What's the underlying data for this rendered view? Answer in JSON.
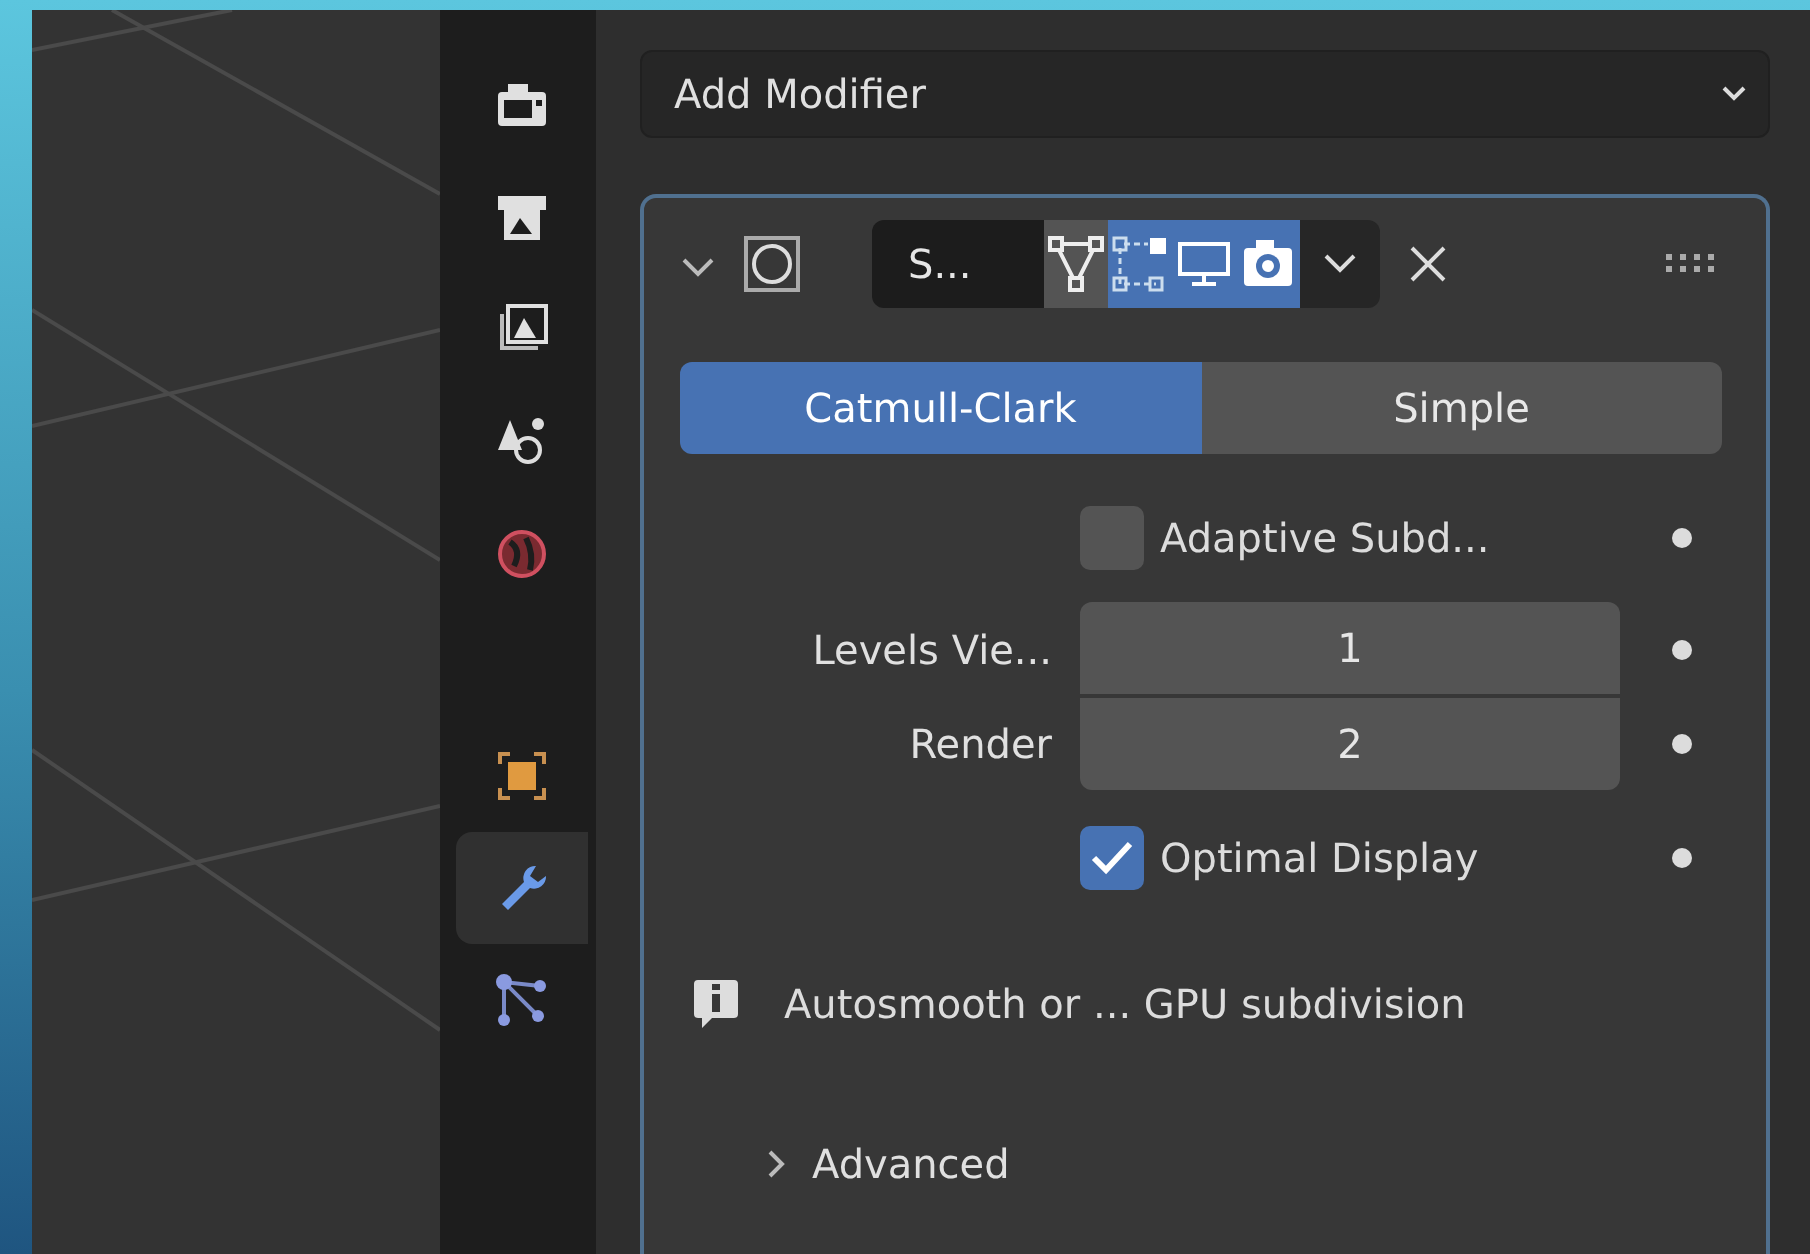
{
  "sidebar": {
    "tab_groups": [
      [
        {
          "selected": false
        },
        {
          "selected": false
        },
        {
          "selected": false
        },
        {
          "selected": false
        },
        {
          "selected": false
        }
      ],
      [
        {
          "selected": false
        },
        {
          "selected": true
        },
        {
          "selected": false
        }
      ]
    ]
  },
  "add_modifier": {
    "label": "Add Modifier"
  },
  "modifier": {
    "expanded": true,
    "name": "S...",
    "toggles": [
      {
        "on": false
      },
      {
        "on": true
      },
      {
        "on": true
      },
      {
        "on": true
      }
    ],
    "subdivision_type": [
      {
        "label": "Catmull-Clark",
        "selected": true
      },
      {
        "label": "Simple",
        "selected": false
      }
    ],
    "adaptive": {
      "label": "Adaptive Subd...",
      "checked": false
    },
    "levels": [
      {
        "label": "Levels Vie...",
        "value": "1"
      },
      {
        "label": "Render",
        "value": "2"
      }
    ],
    "optimal_display": {
      "label": "Optimal Display",
      "checked": true
    },
    "info": "Autosmooth or ... GPU subdivision",
    "advanced": {
      "label": "Advanced",
      "expanded": false
    }
  }
}
